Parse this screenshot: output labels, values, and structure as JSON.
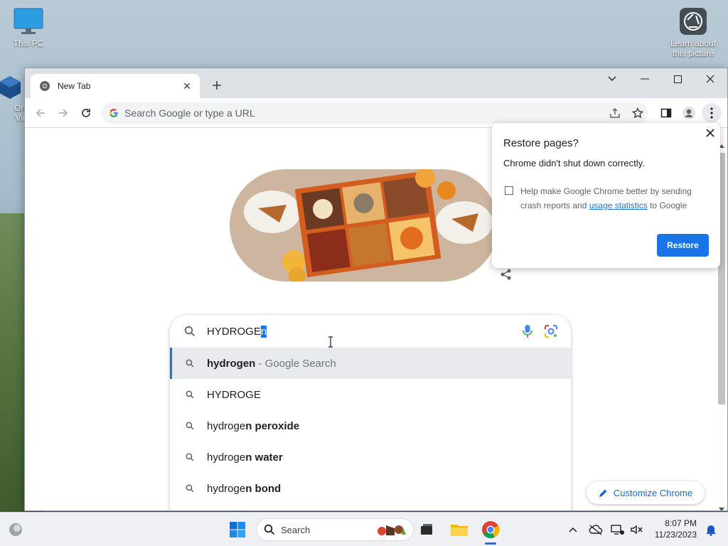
{
  "desktop": {
    "this_pc_label": "This PC",
    "learn_label": "Learn about this picture",
    "oracle_label": "Orac\nVirtu"
  },
  "browser": {
    "tab_title": "New Tab",
    "omnibox_placeholder": "Search Google or type a URL",
    "icons": [
      "back-icon",
      "forward-icon",
      "reload-icon",
      "share-icon",
      "star-icon",
      "side-panel-icon",
      "profile-icon",
      "menu-icon"
    ]
  },
  "page": {
    "search_typed": "HYDROGE",
    "search_selected": "n",
    "suggestions": [
      {
        "prefix": "hydrogen",
        "rest": "",
        "muted": " - Google Search",
        "bold": ""
      },
      {
        "prefix": "HYDROGE",
        "rest": "",
        "muted": "",
        "bold": ""
      },
      {
        "prefix": "hydroge",
        "rest": "",
        "muted": "",
        "bold": "n peroxide"
      },
      {
        "prefix": "hydroge",
        "rest": "",
        "muted": "",
        "bold": "n water"
      },
      {
        "prefix": "hydroge",
        "rest": "",
        "muted": "",
        "bold": "n bond"
      }
    ],
    "customize_label": "Customize Chrome"
  },
  "restore_dialog": {
    "title": "Restore pages?",
    "body": "Chrome didn't shut down correctly.",
    "check_text_1": "Help make Google Chrome better by sending crash reports and ",
    "check_link": "usage statistics",
    "check_text_2": " to Google",
    "restore_label": "Restore"
  },
  "taskbar": {
    "search_label": "Search",
    "time": "8:07 PM",
    "date": "11/23/2023"
  },
  "colors": {
    "accent": "#1a73e8",
    "taskbar": "#eef0f3"
  }
}
